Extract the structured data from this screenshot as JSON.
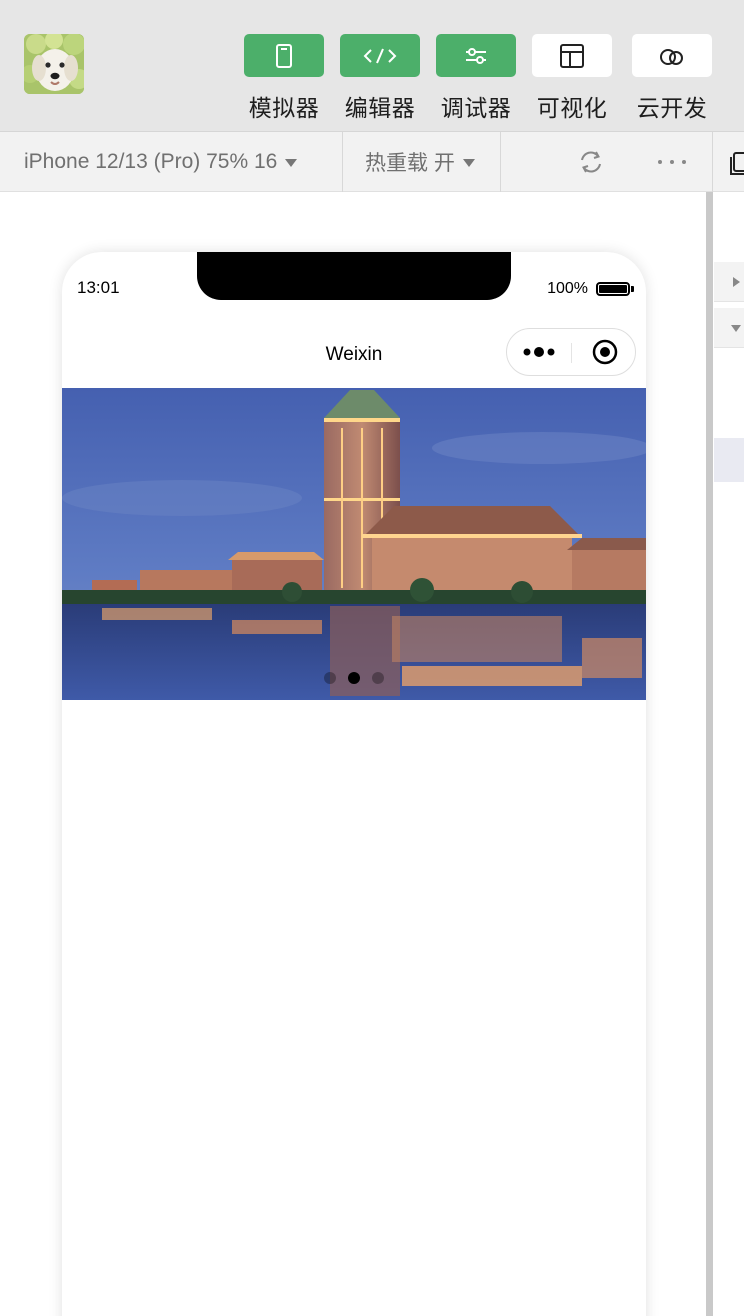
{
  "toolbar": {
    "tools": [
      {
        "label": "模拟器",
        "icon": "phone-icon",
        "active": true
      },
      {
        "label": "编辑器",
        "icon": "code-icon",
        "active": true
      },
      {
        "label": "调试器",
        "icon": "sliders-icon",
        "active": true
      },
      {
        "label": "可视化",
        "icon": "layout-icon",
        "active": false
      },
      {
        "label": "云开发",
        "icon": "cloud-icon",
        "active": false
      }
    ],
    "accent": "#4caf6a"
  },
  "subbar": {
    "device_label": "iPhone 12/13 (Pro) 75% 16",
    "hot_reload_label": "热重载 开"
  },
  "phone": {
    "time": "13:01",
    "battery": "100%",
    "nav_title": "Weixin",
    "swiper_slide_count": 3,
    "swiper_active_index": 1
  }
}
